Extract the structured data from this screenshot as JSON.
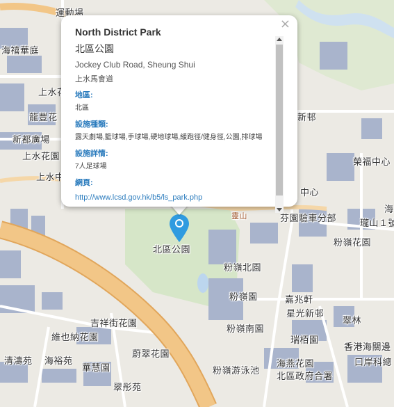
{
  "colors": {
    "land": "#eceae4",
    "park": "#dce8d0",
    "building": "#a9b4cc",
    "highway": "#f2c687",
    "highway_edge": "#e1a65b",
    "road": "#ffffff",
    "water": "#bcd6ee",
    "marker": "#2f9be0"
  },
  "popup": {
    "close_symbol": "×",
    "title": "North District Park",
    "name_zh": "北區公園",
    "address_en": "Jockey Club Road, Sheung Shui",
    "address_zh": "上水馬會道",
    "district_label": "地區:",
    "district_value": "北區",
    "facilities_label": "設施種類:",
    "facilities_value": "露天劇場,籃球場,手球場,硬地球場,緩跑徑/健身徑,公園,排球場",
    "details_label": "設施詳情:",
    "details_value": "7人足球場",
    "web_label": "網頁:",
    "web_url": "http://www.lcsd.gov.hk/b5/ls_park.php"
  },
  "marker": {
    "icon": "map-pin-icon"
  },
  "map_labels": {
    "l1": "運動場",
    "l2": "海禧華庭",
    "l3": "上水花",
    "l4": "龍豐花",
    "l5": "新都廣場",
    "l6": "上水花園",
    "l7": "上水中",
    "l8": "新邨",
    "l9": "榮福中心",
    "l10": "海",
    "l11": "中心",
    "l12": "靈山",
    "l13": "芬園驗車分部",
    "l14": "瓏山１號",
    "l15": "粉嶺花園",
    "l16": "北區公園",
    "l17": "粉嶺北園",
    "l18": "粉嶺園",
    "l19": "嘉兆軒",
    "l20": "星光新邨",
    "l21": "吉祥街花園",
    "l22": "粉嶺南園",
    "l23": "翠林",
    "l24": "維也納花園",
    "l25": "瑞栢園",
    "l26": "香港海關邊",
    "l27": "蔚翠花園",
    "l28": "清濤苑",
    "l29": "海裕苑",
    "l30": "口岸科總",
    "l31": "華慧園",
    "l32": "海燕花園",
    "l33": "粉嶺游泳池",
    "l34": "北區政府合署",
    "l35": "翠彤苑"
  }
}
